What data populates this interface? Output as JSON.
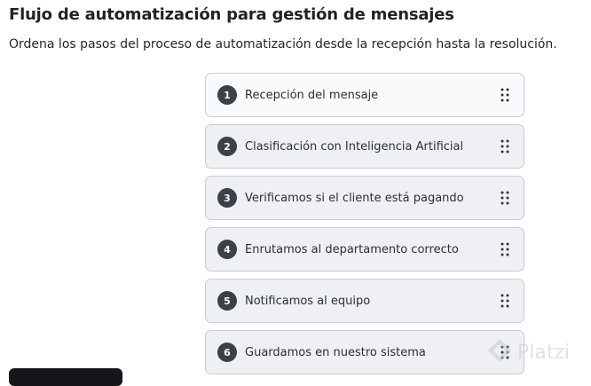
{
  "header": {
    "title": "Flujo de automatización para gestión de mensajes",
    "instructions": "Ordena los pasos del proceso de automatización desde la recepción hasta la resolución."
  },
  "steps": [
    {
      "number": "1",
      "label": "Recepción del mensaje"
    },
    {
      "number": "2",
      "label": "Clasificación con Inteligencia Artificial"
    },
    {
      "number": "3",
      "label": "Verificamos si el cliente está pagando"
    },
    {
      "number": "4",
      "label": "Enrutamos al departamento correcto"
    },
    {
      "number": "5",
      "label": "Notificamos al equipo"
    },
    {
      "number": "6",
      "label": "Guardamos en nuestro sistema"
    }
  ],
  "watermark": {
    "text": "Platzi",
    "icon": "platzi-logo-icon"
  },
  "icons": {
    "drag": "drag-handle-icon"
  },
  "colors": {
    "badge": "#3b4049",
    "card_bg": "#eef0f4",
    "card_border": "#c9ccd3"
  }
}
